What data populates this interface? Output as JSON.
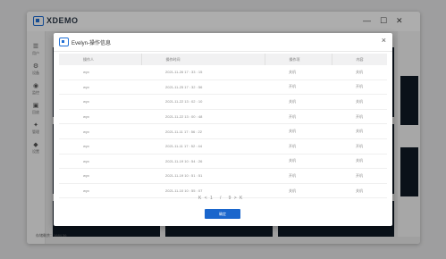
{
  "app": {
    "brand": "XDEMO",
    "window_controls": [
      "—",
      "☐",
      "✕"
    ],
    "sidebar": [
      {
        "icon": "☰",
        "label": "用户"
      },
      {
        "icon": "⚙",
        "label": "设备"
      },
      {
        "icon": "◉",
        "label": "监控"
      },
      {
        "icon": "▣",
        "label": "回放"
      },
      {
        "icon": "✦",
        "label": "管理"
      },
      {
        "icon": "◆",
        "label": "设置"
      }
    ],
    "footer_status": "存储剩余：1684.36"
  },
  "modal": {
    "title": "Evelyn-操作信息",
    "close": "×",
    "columns": [
      "操作人",
      "操作时间",
      "操作项",
      "内容"
    ],
    "rows": [
      [
        "wyx",
        "2021-11-26 17 : 33 : 15",
        "关机",
        "关机"
      ],
      [
        "wyx",
        "2021-11-25 17 : 32 : 56",
        "开机",
        "开机"
      ],
      [
        "wyx",
        "2021-11-22 13 : 02 : 10",
        "关机",
        "关机"
      ],
      [
        "wyx",
        "2021-11-22 13 : 00 : 48",
        "开机",
        "开机"
      ],
      [
        "wyx",
        "2021-11-11 17 : 56 : 22",
        "关机",
        "关机"
      ],
      [
        "wyx",
        "2021-11-11 17 : 52 : 44",
        "开机",
        "开机"
      ],
      [
        "wyx",
        "2021-11-19 10 : 54 : 26",
        "关机",
        "关机"
      ],
      [
        "wyx",
        "2021-11-19 10 : 51 : 51",
        "开机",
        "开机"
      ],
      [
        "wyx",
        "2021-11-10 10 : 55 : 07",
        "关机",
        "关机"
      ]
    ],
    "pagination": {
      "first": "K",
      "prev": "<",
      "current": "1",
      "separator": "/",
      "total": "9",
      "next": ">",
      "last": "K"
    },
    "confirm_label": "确定"
  },
  "colors": {
    "accent": "#1a66cc",
    "overlay": "rgba(0,0,0,0.32)"
  }
}
